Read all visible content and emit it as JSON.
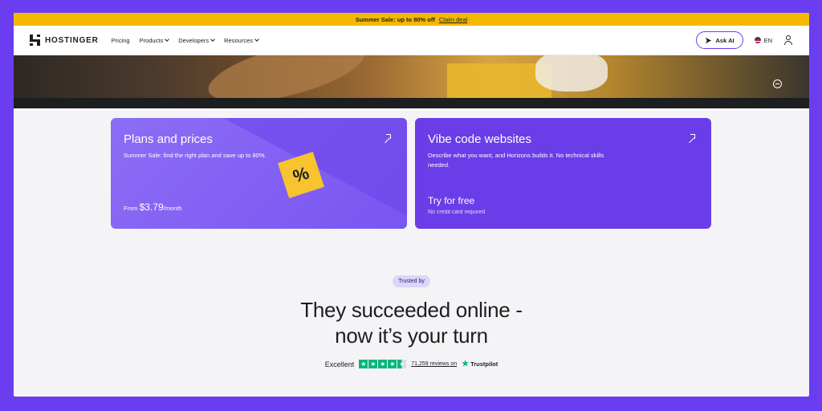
{
  "promo": {
    "text": "Summer Sale: up to 80% off",
    "link": "Claim deal"
  },
  "nav": {
    "logo": "HOSTINGER",
    "links": [
      "Pricing",
      "Products",
      "Developers",
      "Resources"
    ],
    "ask_ai": "Ask AI",
    "lang": "EN"
  },
  "cards": {
    "plans": {
      "title": "Plans and prices",
      "desc": "Summer Sale: find the right plan and save up to 80%.",
      "price_prefix": "From",
      "price": "$3.79",
      "price_suffix": "/month",
      "tag": "%"
    },
    "vibe": {
      "title": "Vibe code websites",
      "desc": "Describe what you want, and Horizons builds it. No technical skills needed.",
      "cta": "Try for free",
      "note": "No credit card required"
    }
  },
  "trusted": {
    "badge": "Trusted by",
    "headline_1": "They succeeded online -",
    "headline_2": "now it’s your turn",
    "rating_label": "Excellent",
    "reviews": "71,259 reviews on",
    "brand": "Trustpilot"
  },
  "colors": {
    "accent": "#673de6",
    "promo_bg": "#f5b800",
    "trustpilot": "#00b67a"
  },
  "icons": {
    "ask_ai": "sparkle-icon",
    "user": "user-icon",
    "card_arrow": "arrow-up-right-icon"
  }
}
